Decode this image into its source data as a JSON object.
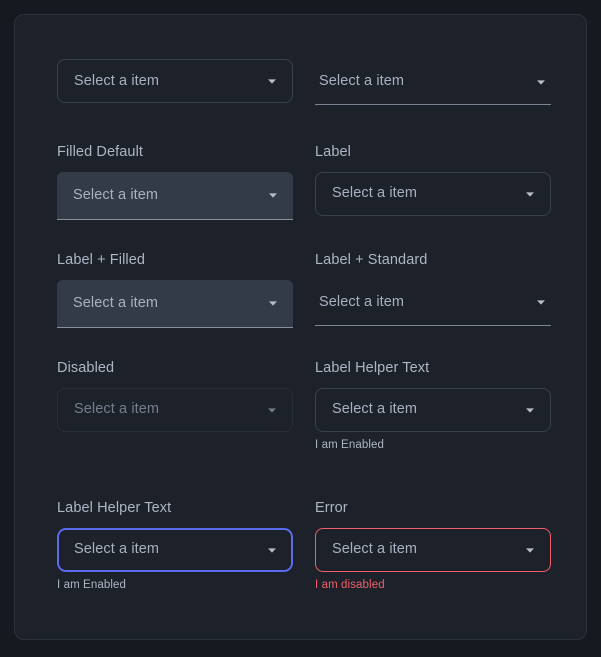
{
  "page": {
    "background_color": "#16191f",
    "panel_background_color": "#1c212a",
    "panel_border_color": "#2b323d"
  },
  "colors": {
    "text_primary": "#aeb6c4",
    "text_value": "#a9b1c0",
    "text_disabled": "#757e8d",
    "outline_border": "#39414e",
    "filled_background": "#333b47",
    "standard_underline": "#7b8493",
    "focus_border": "#5a6bf0",
    "error": "#ef5f68"
  },
  "icons": {
    "caret": "chevron-down-icon"
  },
  "fields": [
    {
      "id": "outlined-default",
      "label": "",
      "variant": "outlined",
      "value": "Select a item",
      "helper": "",
      "column": "left",
      "row": 1
    },
    {
      "id": "standard-default",
      "label": "",
      "variant": "standard",
      "value": "Select a item",
      "helper": "",
      "column": "right",
      "row": 1
    },
    {
      "id": "filled-default",
      "label": "Filled Default",
      "variant": "filled",
      "value": "Select a item",
      "helper": "",
      "column": "left",
      "row": 2
    },
    {
      "id": "label-outlined",
      "label": "Label",
      "variant": "outlined",
      "value": "Select a item",
      "helper": "",
      "column": "right",
      "row": 2
    },
    {
      "id": "label-filled",
      "label": "Label + Filled",
      "variant": "filled",
      "value": "Select a item",
      "helper": "",
      "column": "left",
      "row": 3
    },
    {
      "id": "label-standard",
      "label": "Label + Standard",
      "variant": "standard",
      "value": "Select a item",
      "helper": "",
      "column": "right",
      "row": 3
    },
    {
      "id": "disabled",
      "label": "Disabled",
      "variant": "disabled",
      "value": "Select a item",
      "helper": "",
      "column": "left",
      "row": 4
    },
    {
      "id": "label-helper-right",
      "label": "Label Helper Text",
      "variant": "outlined",
      "value": "Select a item",
      "helper": "I am Enabled",
      "column": "right",
      "row": 4
    },
    {
      "id": "label-helper-focused",
      "label": "Label Helper Text",
      "variant": "focused",
      "value": "Select a item",
      "helper": "I am Enabled",
      "column": "left",
      "row": 5
    },
    {
      "id": "error",
      "label": "Error",
      "variant": "error",
      "value": "Select a item",
      "helper": "I am disabled",
      "column": "right",
      "row": 5
    }
  ]
}
